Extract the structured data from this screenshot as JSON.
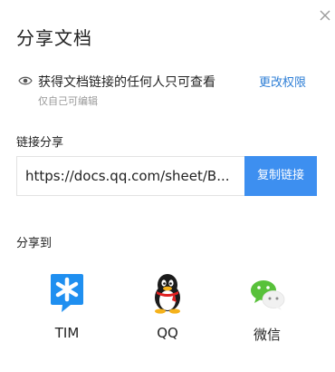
{
  "dialog": {
    "title": "分享文档"
  },
  "permission": {
    "icon": "eye-icon",
    "text": "获得文档链接的任何人只可查看",
    "change_label": "更改权限",
    "sub": "仅自己可编辑"
  },
  "link_share": {
    "label": "链接分享",
    "url": "https://docs.qq.com/sheet/B...",
    "copy_label": "复制链接",
    "accent": "#3d8ff0"
  },
  "share_to": {
    "label": "分享到",
    "targets": [
      {
        "label": "TIM",
        "icon": "tim-icon"
      },
      {
        "label": "QQ",
        "icon": "qq-penguin-icon"
      },
      {
        "label": "微信",
        "icon": "wechat-icon"
      }
    ]
  },
  "colors": {
    "link_blue": "#2f7fd6",
    "tim_blue": "#1f8ff0",
    "wechat_green": "#58c13a"
  }
}
